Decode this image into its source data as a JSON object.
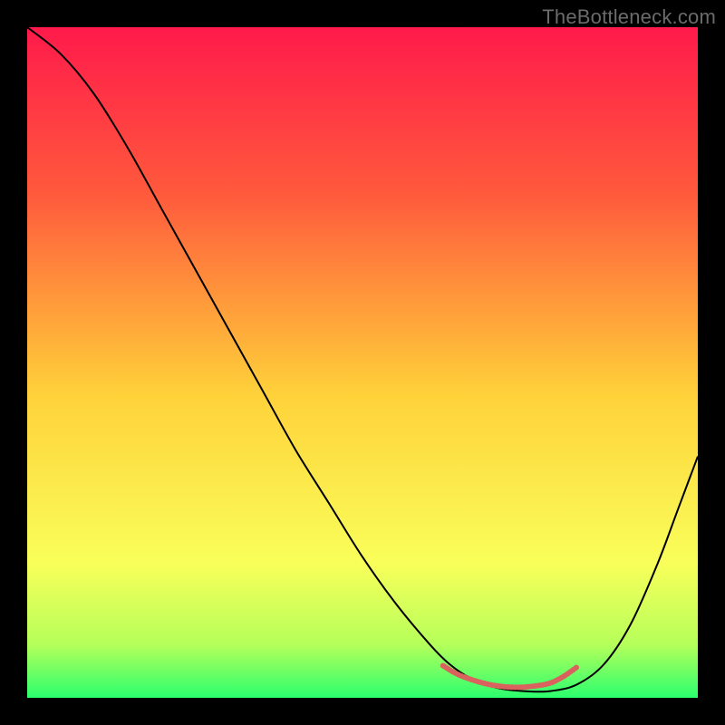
{
  "watermark": "TheBottleneck.com",
  "chart_data": {
    "type": "line",
    "title": "",
    "xlabel": "",
    "ylabel": "",
    "xlim": [
      0,
      100
    ],
    "ylim": [
      0,
      100
    ],
    "axes_visible": false,
    "background_gradient": {
      "stops": [
        {
          "pos": 0.0,
          "color": "#ff1a4b"
        },
        {
          "pos": 0.25,
          "color": "#ff5a3c"
        },
        {
          "pos": 0.55,
          "color": "#ffd23a"
        },
        {
          "pos": 0.8,
          "color": "#f9ff5a"
        },
        {
          "pos": 0.92,
          "color": "#b6ff5a"
        },
        {
          "pos": 1.0,
          "color": "#2bff6e"
        }
      ]
    },
    "series": [
      {
        "name": "bottleneck-curve",
        "color": "#000000",
        "x": [
          0,
          5,
          10,
          15,
          20,
          25,
          30,
          35,
          40,
          45,
          50,
          55,
          60,
          63,
          66,
          70,
          74,
          78,
          82,
          86,
          90,
          94,
          97,
          100
        ],
        "y": [
          100,
          96,
          90,
          82,
          73,
          64,
          55,
          46,
          37,
          29,
          21,
          14,
          8,
          5,
          3,
          1.5,
          1,
          1,
          2,
          5,
          11,
          20,
          28,
          36
        ]
      },
      {
        "name": "optimal-range-marker",
        "color": "#d9625e",
        "x": [
          62,
          64,
          66,
          68,
          70,
          72,
          74,
          76,
          78,
          80,
          82
        ],
        "y": [
          4.8,
          3.6,
          2.8,
          2.2,
          1.8,
          1.6,
          1.6,
          1.8,
          2.2,
          3.2,
          4.6
        ]
      }
    ]
  }
}
